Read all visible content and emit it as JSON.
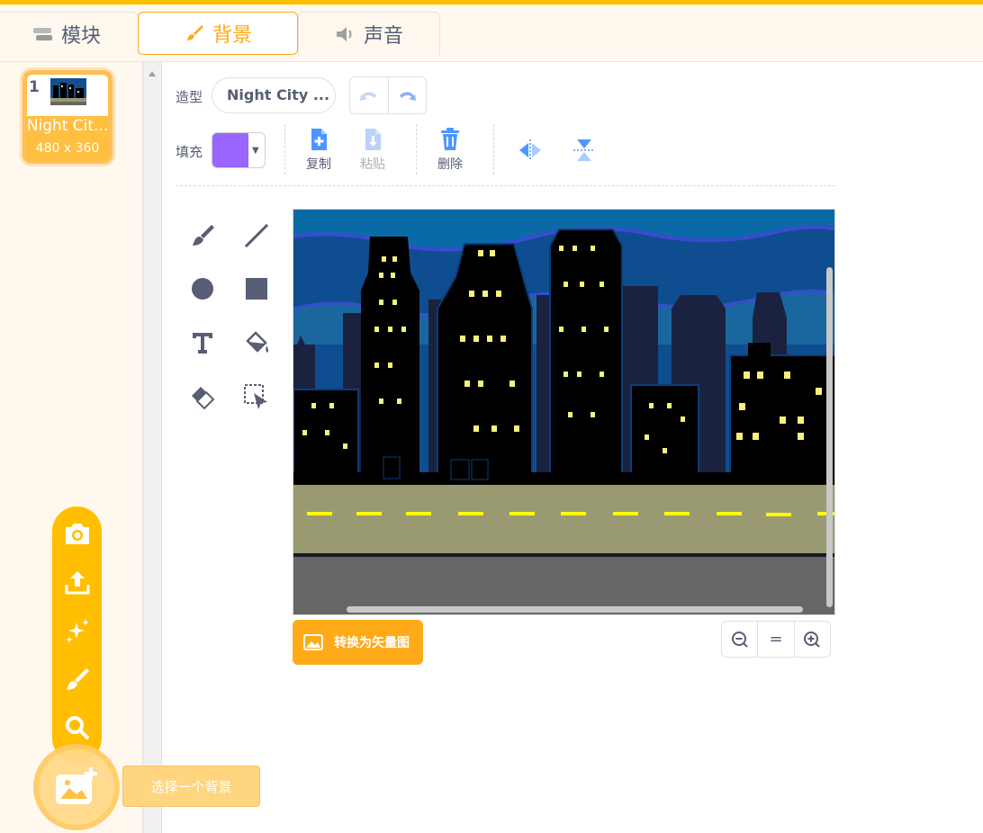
{
  "tabs": [
    {
      "label": "模块",
      "icon": "code-blocks-icon",
      "active": false
    },
    {
      "label": "背景",
      "icon": "paintbrush-icon",
      "active": true
    },
    {
      "label": "声音",
      "icon": "speaker-icon",
      "active": false
    }
  ],
  "backdrop_list": {
    "items": [
      {
        "number": "1",
        "name": "Night Cit...",
        "size": "480 x 360",
        "selected": true
      }
    ]
  },
  "editor": {
    "costume_label": "造型",
    "costume_name": "Night City ...",
    "fill_label": "填充",
    "fill_color": "#9966ff",
    "actions": {
      "copy": "复制",
      "paste": "粘贴",
      "delete": "删除"
    },
    "tools": [
      "brush-tool",
      "line-tool",
      "circle-tool",
      "rectangle-tool",
      "text-tool",
      "fill-tool",
      "eraser-tool",
      "select-tool"
    ],
    "convert_button": "转换为矢量图",
    "zoom": {
      "out": "−",
      "reset": "=",
      "in": "+"
    }
  },
  "backdrop_menu": {
    "items": [
      "camera-icon",
      "upload-icon",
      "surprise-icon",
      "paint-icon",
      "search-icon"
    ],
    "tooltip": "选择一个背景"
  },
  "colors": {
    "accent": "#ffab19",
    "topbar": "#ffbf00",
    "fill": "#9966ff",
    "text": "#575e75"
  }
}
